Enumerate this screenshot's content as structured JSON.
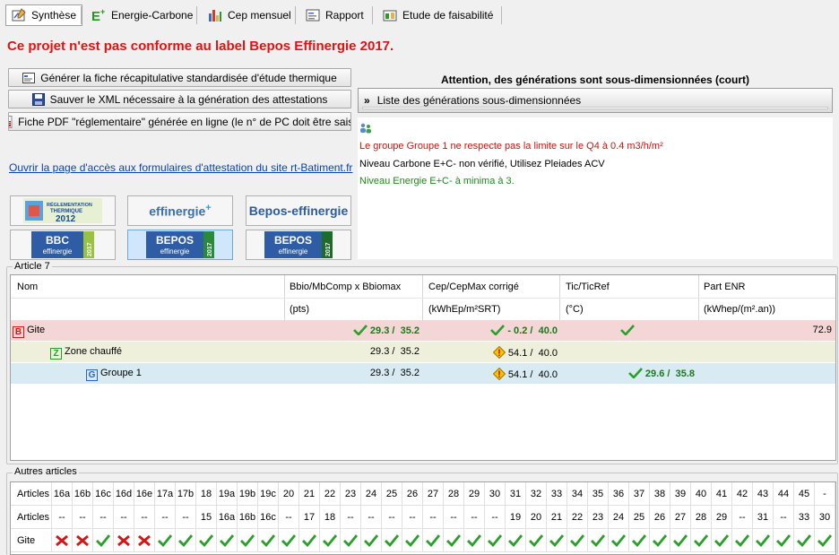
{
  "toolbar": {
    "tabs": [
      {
        "label": "Synthèse",
        "icon": "synthesis-icon"
      },
      {
        "label": "Energie-Carbone",
        "icon": "eplus-icon"
      },
      {
        "label": "Cep mensuel",
        "icon": "bar-chart-icon"
      },
      {
        "label": "Rapport",
        "icon": "report-icon"
      },
      {
        "label": "Etude de faisabilité",
        "icon": "feasibility-icon"
      }
    ]
  },
  "status": {
    "heading": "Ce projet n'est pas conforme au label Bepos Effinergie 2017.",
    "color": "#e21212"
  },
  "actions": {
    "generate_label": "Générer la fiche récapitulative standardisée d'étude thermique",
    "save_xml_label": "Sauver le XML nécessaire à la génération des attestations",
    "pdf_label": "Fiche PDF \"réglementaire\" générée en ligne (le n° de PC doit être saisi)",
    "rt_link": "Ouvrir la page d'accès aux formulaires d'attestation du site rt-Batiment.fr"
  },
  "logos": {
    "rt2012": {
      "line1": "RÉGLEMENTATION",
      "line2": "THERMIQUE",
      "year": "2012"
    },
    "effinergie_plus": {
      "text": "effinergie",
      "suffix": "+"
    },
    "bepos_effinergie": {
      "text": "Bepos-effinergie"
    },
    "bbc2017": {
      "title": "BBC",
      "sub": "effinergie",
      "year": "2017"
    },
    "bepos2017": {
      "title": "BEPOS",
      "sub": "effinergie",
      "year": "2017"
    },
    "beposplus2017": {
      "title": "BEPOS",
      "sub": "effinergie",
      "year": "2017"
    }
  },
  "warnings": {
    "title": "Attention, des générations sont sous-dimensionnées (court)",
    "dropdown_prefix": "»",
    "dropdown_label": "Liste des générations sous-dimensionnées",
    "messages": [
      {
        "text": "Le groupe Groupe 1 ne respecte pas la limite sur le Q4 à 0.4 m3/h/m²",
        "color": "#d01010"
      },
      {
        "text": "Niveau Carbone E+C- non vérifié, Utilisez Pleiades ACV",
        "color": "#000000"
      },
      {
        "text": "Niveau Energie E+C- à minima à 3.",
        "color": "#1a8a1a"
      }
    ]
  },
  "article7": {
    "group_label": "Article 7",
    "headers": [
      "Nom",
      "Bbio/MbComp x Bbiomax",
      "Cep/CepMax corrigé",
      "Tic/TicRef",
      "Part ENR"
    ],
    "units": [
      "",
      "(pts)",
      "(kWhEp/m²SRT)",
      "(°C)",
      "(kWhep/(m².an))"
    ],
    "rows": [
      {
        "badge": "B",
        "badge_color": "#d01818",
        "name": "Gite",
        "bbio_a": "29.3 /",
        "bbio_b": "35.2",
        "cep_a": "- 0.2 /",
        "cep_b": "40.0",
        "tic_a": "",
        "tic_b": "",
        "enr": "72.9",
        "bg": "#f4d6d6"
      },
      {
        "badge": "Z",
        "badge_color": "#2a9a2a",
        "name": "Zone chauffé",
        "bbio_a": "29.3 /",
        "bbio_b": "35.2",
        "cep_a": "54.1 /",
        "cep_b": "40.0",
        "tic_a": "",
        "tic_b": "",
        "enr": "",
        "bg": "#eef0dc"
      },
      {
        "badge": "G",
        "badge_color": "#2a63c4",
        "name": "Groupe 1",
        "bbio_a": "29.3 /",
        "bbio_b": "35.2",
        "cep_a": "54.1 /",
        "cep_b": "40.0",
        "tic_a": "29.6 /",
        "tic_b": "35.8",
        "enr": "",
        "bg": "#d9ebf2"
      }
    ]
  },
  "autres": {
    "group_label": "Autres articles",
    "row_labels": [
      "Articles",
      "Articles",
      "Gite"
    ],
    "articles_row1": [
      "16a",
      "16b",
      "16c",
      "16d",
      "16e",
      "17a",
      "17b",
      "18",
      "19a",
      "19b",
      "19c",
      "20",
      "21",
      "22",
      "23",
      "24",
      "25",
      "26",
      "27",
      "28",
      "29",
      "30",
      "31",
      "32",
      "33",
      "34",
      "35",
      "36",
      "37",
      "38",
      "39",
      "40",
      "41",
      "42",
      "43",
      "44",
      "45",
      "-"
    ],
    "articles_row2": [
      "--",
      "--",
      "--",
      "--",
      "--",
      "--",
      "--",
      "15",
      "16a",
      "16b",
      "16c",
      "--",
      "17",
      "18",
      "--",
      "--",
      "--",
      "--",
      "--",
      "--",
      "--",
      "--",
      "19",
      "20",
      "21",
      "22",
      "23",
      "24",
      "25",
      "26",
      "27",
      "28",
      "29",
      "--",
      "31",
      "--",
      "33",
      "30"
    ],
    "gite_results": [
      "fail",
      "fail",
      "pass",
      "fail",
      "fail",
      "pass",
      "pass",
      "pass",
      "pass",
      "pass",
      "pass",
      "pass",
      "pass",
      "pass",
      "pass",
      "pass",
      "pass",
      "pass",
      "pass",
      "pass",
      "pass",
      "pass",
      "pass",
      "pass",
      "pass",
      "pass",
      "pass",
      "pass",
      "pass",
      "pass",
      "pass",
      "pass",
      "pass",
      "pass",
      "pass",
      "pass",
      "pass",
      "pass"
    ]
  }
}
